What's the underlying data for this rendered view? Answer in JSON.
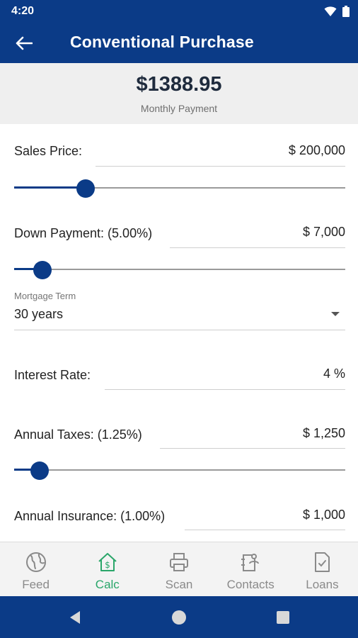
{
  "status_bar": {
    "time": "4:20"
  },
  "app_bar": {
    "title": "Conventional Purchase"
  },
  "summary": {
    "amount": "$1388.95",
    "label": "Monthly Payment"
  },
  "sales_price": {
    "label": "Sales Price:",
    "value": "$ 200,000",
    "slider_fraction": 0.215
  },
  "down_payment": {
    "label": "Down Payment: (5.00%)",
    "value": "$ 7,000",
    "slider_fraction": 0.085
  },
  "mortgage_term": {
    "label": "Mortgage Term",
    "value": "30 years"
  },
  "interest_rate": {
    "label": "Interest Rate:",
    "value": "4 %"
  },
  "annual_taxes": {
    "label": "Annual Taxes: (1.25%)",
    "value": "$ 1,250",
    "slider_fraction": 0.077
  },
  "annual_insurance": {
    "label": "Annual Insurance: (1.00%)",
    "value": "$ 1,000"
  },
  "bottom_nav": {
    "items": [
      {
        "label": "Feed",
        "icon": "globe-icon"
      },
      {
        "label": "Calc",
        "icon": "home-dollar-icon",
        "active": true
      },
      {
        "label": "Scan",
        "icon": "printer-icon"
      },
      {
        "label": "Contacts",
        "icon": "contacts-icon"
      },
      {
        "label": "Loans",
        "icon": "document-check-icon"
      }
    ]
  },
  "colors": {
    "primary": "#0b3b87",
    "active_nav": "#2aa66a",
    "summary_bg": "#efefef"
  }
}
